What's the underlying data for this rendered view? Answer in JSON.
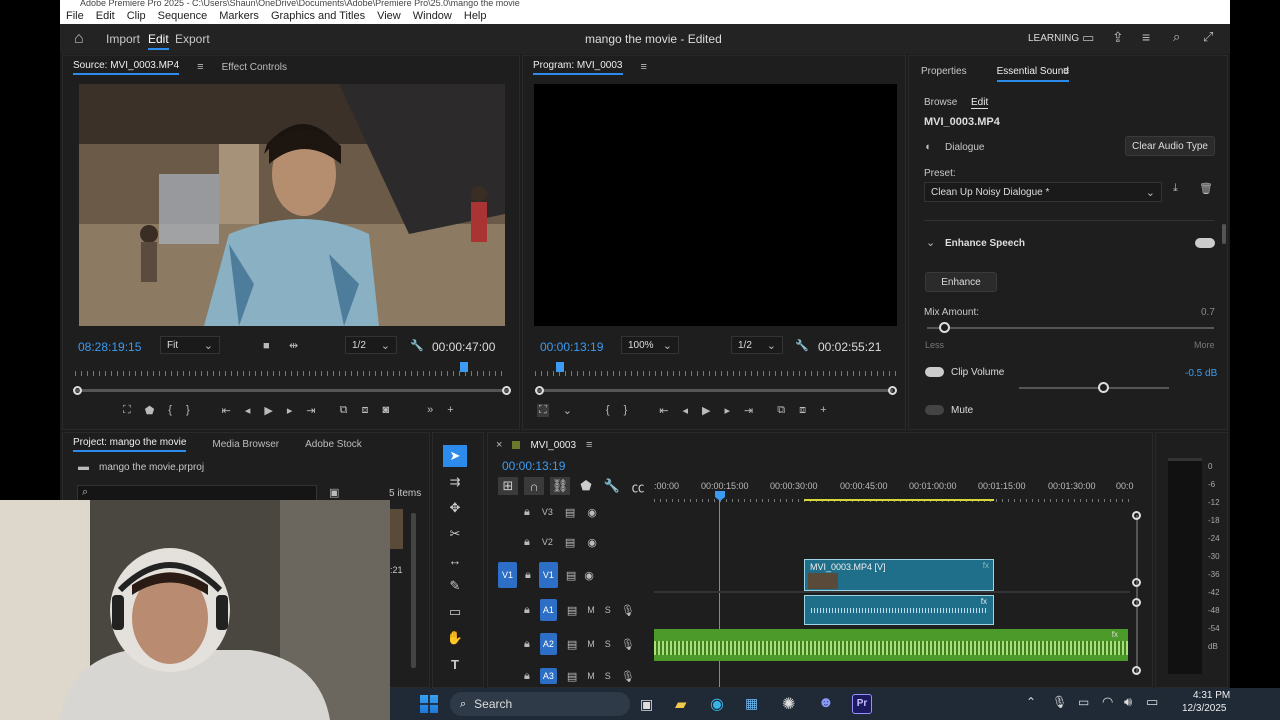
{
  "titlebar": {
    "text": "Adobe Premiere Pro 2025 - C:\\Users\\Shaun\\OneDrive\\Documents\\Adobe\\Premiere Pro\\25.0\\mango the movie"
  },
  "menu": [
    "File",
    "Edit",
    "Clip",
    "Sequence",
    "Markers",
    "Graphics and Titles",
    "View",
    "Window",
    "Help"
  ],
  "appbar": {
    "import": "Import",
    "edit": "Edit",
    "export": "Export",
    "project_title": "mango the movie - Edited",
    "learning": "LEARNING"
  },
  "source": {
    "tab": "Source: MVI_0003.MP4",
    "tab2": "Effect Controls",
    "timecode": "08:28:19:15",
    "fit": "Fit",
    "res": "1/2",
    "duration": "00:00:47:00",
    "playhead_frac": 0.9
  },
  "program": {
    "tab": "Program: MVI_0003",
    "timecode": "00:00:13:19",
    "zoom": "100%",
    "res": "1/2",
    "duration": "00:02:55:21",
    "playhead_frac": 0.07
  },
  "essential": {
    "tab1": "Properties",
    "tab2": "Essential Sound",
    "browse": "Browse",
    "edit": "Edit",
    "clip": "MVI_0003.MP4",
    "type": "Dialogue",
    "clear": "Clear Audio Type",
    "preset_label": "Preset:",
    "preset": "Clean Up Noisy Dialogue *",
    "enhance_speech": "Enhance Speech",
    "enhance_btn": "Enhance",
    "mix_label": "Mix Amount:",
    "mix_value": "0.7",
    "mix_frac": 0.06,
    "less": "Less",
    "more": "More",
    "clip_volume": "Clip Volume",
    "clip_volume_value": "-0.5 dB",
    "clip_volume_frac": 0.56,
    "mute": "Mute"
  },
  "project": {
    "tab1": "Project: mango the movie",
    "tab2": "Media Browser",
    "tab3": "Adobe Stock",
    "file": "mango the movie.prproj",
    "items": "5 items",
    "snippet": ":21"
  },
  "timeline": {
    "tab": "MVI_0003",
    "timecode": "00:00:13:19",
    "ticks": [
      ":00:00",
      "00:00:15:00",
      "00:00:30:00",
      "00:00:45:00",
      "00:01:00:00",
      "00:01:15:00",
      "00:01:30:00",
      "00:0"
    ],
    "tracks": {
      "v3": "V3",
      "v2": "V2",
      "v1": "V1",
      "a1": "A1",
      "a2": "A2",
      "a3": "A3",
      "src_v1": "V1",
      "m": "M",
      "s": "S"
    },
    "clip_label": "MVI_0003.MP4 [V]"
  },
  "meter": {
    "labels": [
      "0",
      "-6",
      "-12",
      "-18",
      "-24",
      "-30",
      "-36",
      "-42",
      "-48",
      "-54",
      "dB"
    ]
  },
  "taskbar": {
    "search": "Search",
    "time": "4:31 PM",
    "date": "12/3/2025"
  },
  "colors": {
    "accent": "#2d8ceb",
    "clip_video": "#1f6f8b",
    "clip_audio_green": "#4c9a2a"
  }
}
